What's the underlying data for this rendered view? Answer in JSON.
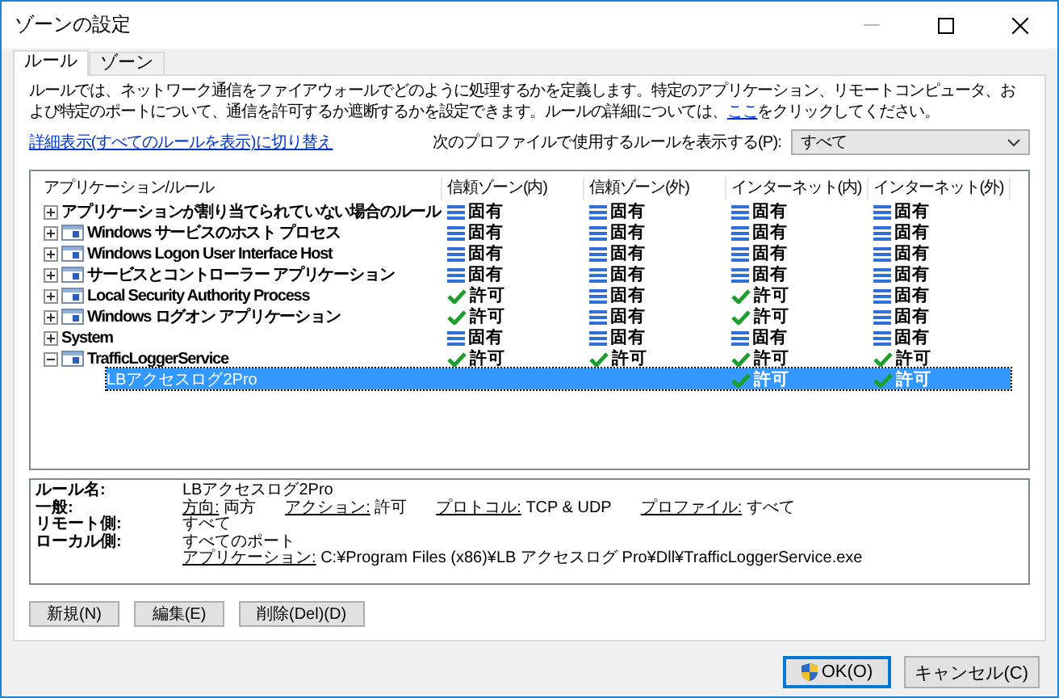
{
  "window": {
    "title": "ゾーンの設定"
  },
  "tabs": [
    {
      "label": "ルール",
      "selected": true
    },
    {
      "label": "ゾーン",
      "selected": false
    }
  ],
  "description": {
    "text": "ルールでは、ネットワーク通信をファイアウォールでどのように処理するかを定義します。特定のアプリケーション、リモートコンピュータ、および特定のポートについて、通信を許可するか遮断するかを設定できます。ルールの詳細については、",
    "link": "ここ",
    "after": "をクリックしてください。"
  },
  "detail_link": "詳細表示(すべてのルールを表示)に切り替え",
  "profile_filter": {
    "label": "次のプロファイルで使用するルールを表示する(P):",
    "value": "すべて"
  },
  "table": {
    "name_column": "アプリケーション/ルール",
    "columns": [
      "信頼ゾーン(内)",
      "信頼ゾーン(外)",
      "インターネット(内)",
      "インターネット(外)"
    ],
    "rows": [
      {
        "name": "アプリケーションが割り当てられていない場合のルール",
        "icon": false,
        "expanded": false,
        "cells": [
          {
            "kind": "inherit",
            "text": "固有"
          },
          {
            "kind": "inherit",
            "text": "固有"
          },
          {
            "kind": "inherit",
            "text": "固有"
          },
          {
            "kind": "inherit",
            "text": "固有"
          }
        ]
      },
      {
        "name": "Windows サービスのホスト プロセス",
        "icon": true,
        "expanded": false,
        "cells": [
          {
            "kind": "inherit",
            "text": "固有"
          },
          {
            "kind": "inherit",
            "text": "固有"
          },
          {
            "kind": "inherit",
            "text": "固有"
          },
          {
            "kind": "inherit",
            "text": "固有"
          }
        ]
      },
      {
        "name": "Windows Logon User Interface Host",
        "icon": true,
        "expanded": false,
        "cells": [
          {
            "kind": "inherit",
            "text": "固有"
          },
          {
            "kind": "inherit",
            "text": "固有"
          },
          {
            "kind": "inherit",
            "text": "固有"
          },
          {
            "kind": "inherit",
            "text": "固有"
          }
        ]
      },
      {
        "name": "サービスとコントローラー アプリケーション",
        "icon": true,
        "expanded": false,
        "cells": [
          {
            "kind": "inherit",
            "text": "固有"
          },
          {
            "kind": "inherit",
            "text": "固有"
          },
          {
            "kind": "inherit",
            "text": "固有"
          },
          {
            "kind": "inherit",
            "text": "固有"
          }
        ]
      },
      {
        "name": "Local Security Authority Process",
        "icon": true,
        "expanded": false,
        "cells": [
          {
            "kind": "allow",
            "text": "許可"
          },
          {
            "kind": "inherit",
            "text": "固有"
          },
          {
            "kind": "allow",
            "text": "許可"
          },
          {
            "kind": "inherit",
            "text": "固有"
          }
        ]
      },
      {
        "name": "Windows ログオン アプリケーション",
        "icon": true,
        "expanded": false,
        "cells": [
          {
            "kind": "allow",
            "text": "許可"
          },
          {
            "kind": "inherit",
            "text": "固有"
          },
          {
            "kind": "allow",
            "text": "許可"
          },
          {
            "kind": "inherit",
            "text": "固有"
          }
        ]
      },
      {
        "name": "System",
        "icon": false,
        "expanded": false,
        "cells": [
          {
            "kind": "inherit",
            "text": "固有"
          },
          {
            "kind": "inherit",
            "text": "固有"
          },
          {
            "kind": "inherit",
            "text": "固有"
          },
          {
            "kind": "inherit",
            "text": "固有"
          }
        ]
      },
      {
        "name": "TrafficLoggerService",
        "icon": true,
        "expanded": true,
        "cells": [
          {
            "kind": "allow",
            "text": "許可"
          },
          {
            "kind": "allow",
            "text": "許可"
          },
          {
            "kind": "allow",
            "text": "許可"
          },
          {
            "kind": "allow",
            "text": "許可"
          }
        ],
        "children": [
          {
            "name": "LBアクセスログ2Pro",
            "selected": true,
            "cells": [
              null,
              null,
              {
                "kind": "allow",
                "text": "許可"
              },
              {
                "kind": "allow",
                "text": "許可"
              }
            ]
          }
        ]
      }
    ]
  },
  "details": [
    {
      "label": "ルール名:",
      "fields": [
        {
          "value": "LBアクセスログ2Pro"
        }
      ]
    },
    {
      "label": "一般:",
      "fields": [
        {
          "label": "方向:",
          "value": "両方"
        },
        {
          "label": "アクション:",
          "value": "許可"
        },
        {
          "label": "プロトコル:",
          "value": "TCP & UDP"
        },
        {
          "label": "プロファイル:",
          "value": "すべて"
        }
      ]
    },
    {
      "label": "リモート側:",
      "fields": [
        {
          "value": "すべて"
        }
      ]
    },
    {
      "label": "ローカル側:",
      "fields": [
        {
          "value": "すべてのポート"
        }
      ]
    },
    {
      "fields": [
        {
          "label": "アプリケーション:",
          "value": "C:¥Program Files (x86)¥LB アクセスログ Pro¥Dll¥TrafficLoggerService.exe"
        }
      ]
    }
  ],
  "rule_buttons": [
    "新規(N)",
    "編集(E)",
    "削除(Del)(D)"
  ],
  "dialog_buttons": [
    {
      "label": "OK(O)",
      "kind": "shield",
      "default": true
    },
    {
      "label": "キャンセル(C)",
      "kind": "plain",
      "default": false
    }
  ]
}
